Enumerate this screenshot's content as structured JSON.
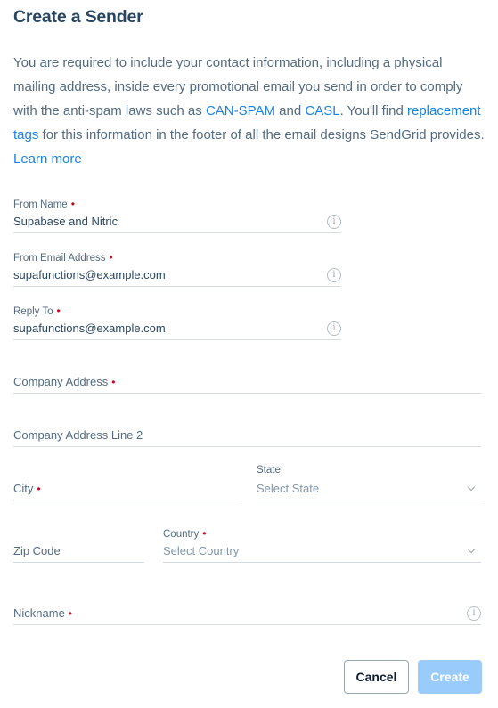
{
  "header": {
    "title": "Create a Sender"
  },
  "intro": {
    "text_1": "You are required to include your contact information, including a physical mailing address, inside every promotional email you send in order to comply with the anti-spam laws such as ",
    "link_canspam": "CAN-SPAM",
    "text_2": " and ",
    "link_casl": "CASL",
    "text_3": ". You'll find ",
    "link_replacement_tags": "replacement tags",
    "text_4": " for this information in the footer of all the email designs SendGrid provides. ",
    "link_learn_more": "Learn more"
  },
  "colors": {
    "title": "#294661",
    "text": "#546b81",
    "link": "#1a82e2",
    "required": "#c4091e",
    "create_button": "#99ccfd",
    "border": "#d4dadf"
  },
  "form": {
    "required_marker": "•",
    "from_name": {
      "label": "From Name",
      "value": "Supabase and Nitric",
      "required": true,
      "icon": "info-icon"
    },
    "from_email": {
      "label": "From Email Address",
      "value": "supafunctions@example.com",
      "required": true,
      "icon": "info-icon"
    },
    "reply_to": {
      "label": "Reply To",
      "value": "supafunctions@example.com",
      "required": true,
      "icon": "info-icon"
    },
    "company_address": {
      "placeholder": "Company Address",
      "required": true
    },
    "company_address_2": {
      "placeholder": "Company Address Line 2",
      "required": false
    },
    "city": {
      "placeholder": "City",
      "required": true
    },
    "state": {
      "label": "State",
      "selected": "Select State",
      "required": false,
      "icon": "chevron-down-icon"
    },
    "zip": {
      "placeholder": "Zip Code",
      "required": false
    },
    "country": {
      "label": "Country",
      "selected": "Select Country",
      "required": true,
      "icon": "chevron-down-icon"
    },
    "nickname": {
      "placeholder": "Nickname",
      "required": true,
      "icon": "info-icon"
    }
  },
  "actions": {
    "cancel_label": "Cancel",
    "create_label": "Create"
  }
}
